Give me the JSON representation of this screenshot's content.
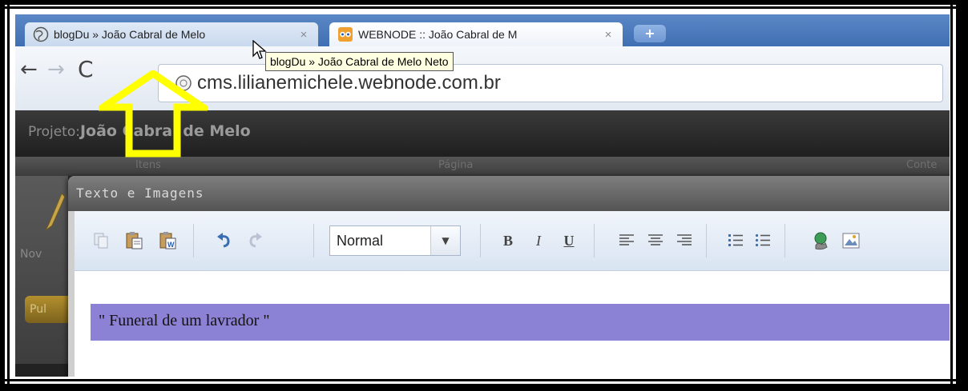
{
  "browser": {
    "tabs": [
      {
        "title": "blogDu » João Cabral de Melo",
        "close": "×"
      },
      {
        "title": "WEBNODE :: João Cabral de M",
        "close": "×"
      }
    ],
    "new_tab_label": "+",
    "nav": {
      "back": "←",
      "forward": "→",
      "reload": "C"
    },
    "url": "cms.lilianemichele.webnode.com.br",
    "tooltip": "blogDu » João Cabral de Melo Neto"
  },
  "cms": {
    "project_label": "Projeto:",
    "project_name": "João Cabral de Melo",
    "columns": [
      "Itens",
      "Página",
      "Conte"
    ],
    "novo_label": "Nov",
    "publish_label": "Pul"
  },
  "dialog": {
    "title": "Texto e Imagens",
    "format_select": {
      "value": "Normal"
    },
    "toolbar_icons": [
      "copy-icon",
      "paste-icon",
      "paste-word-icon",
      "undo-icon",
      "redo-icon",
      "bold-icon",
      "italic-icon",
      "underline-icon",
      "align-left-icon",
      "align-center-icon",
      "align-right-icon",
      "numbered-list-icon",
      "bulleted-list-icon",
      "link-icon",
      "image-icon"
    ],
    "bold": "B",
    "italic": "I",
    "underline": "U",
    "content": "\" Funeral de um lavrador \""
  },
  "colors": {
    "highlight": "#8b81d5",
    "annotation_arrow": "#ffff00",
    "tab_strip": "#4a78bb",
    "dialog_titlebar": "#6a6a6a"
  }
}
